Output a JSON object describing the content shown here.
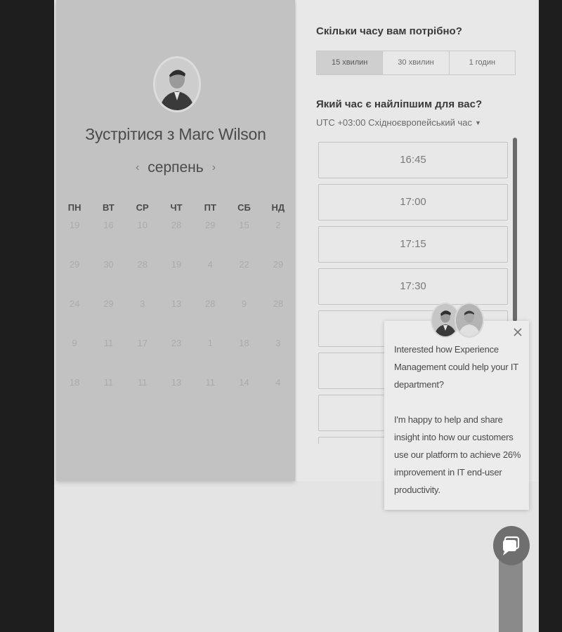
{
  "header": {
    "meet_prefix": "Зустрітися з ",
    "host_name": "Marc Wilson"
  },
  "calendar": {
    "month": "серпень",
    "prev_icon": "chevron-left-icon",
    "next_icon": "chevron-right-icon",
    "weekdays": [
      "ПН",
      "ВТ",
      "СР",
      "ЧТ",
      "ПТ",
      "СБ",
      "НД"
    ],
    "weeks": [
      [
        "19",
        "16",
        "10",
        "28",
        "29",
        "15",
        "2"
      ],
      [
        "29",
        "30",
        "28",
        "19",
        "4",
        "22",
        "29"
      ],
      [
        "24",
        "29",
        "3",
        "13",
        "28",
        "9",
        "28"
      ],
      [
        "9",
        "11",
        "17",
        "23",
        "1",
        "18",
        "3"
      ],
      [
        "18",
        "11",
        "11",
        "13",
        "11",
        "14",
        "4"
      ]
    ]
  },
  "duration": {
    "question": "Скільки часу вам потрібно?",
    "options": [
      "15 хвилин",
      "30 хвилин",
      "1 годин"
    ],
    "selected": "15 хвилин"
  },
  "time": {
    "question": "Який час є найліпшим для вас?",
    "timezone": "UTC +03:00 Східноєвропейський час",
    "slots": [
      "16:45",
      "17:00",
      "17:15",
      "17:30",
      "",
      "",
      "",
      ""
    ]
  },
  "chat": {
    "message1": "Interested how Experience Management could help your IT department?",
    "message2": "I'm happy to help and share insight into how our customers use our platform to achieve 26% improvement in IT end-user productivity.",
    "close_icon": "close-icon",
    "launcher_icon": "chat-bubble-icon"
  },
  "colors": {
    "left_panel": "#c2c2c2",
    "right_panel": "#e8e8e8",
    "background": "#1e1e1e"
  }
}
